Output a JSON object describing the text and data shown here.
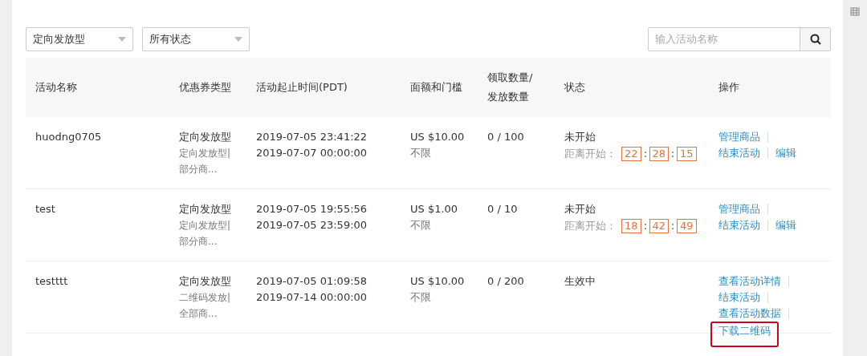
{
  "filters": [
    {
      "value": "定向发放型"
    },
    {
      "value": "所有状态"
    }
  ],
  "search": {
    "placeholder": "输入活动名称"
  },
  "table": {
    "columns": [
      "活动名称",
      "优惠券类型",
      "活动起止时间(PDT)",
      "面额和门槛",
      "领取数量/发放数量",
      "状态",
      "操作"
    ],
    "rows": [
      {
        "name": "huodng0705",
        "type": "定向发放型",
        "type_detail": "定向发放型|部分商...",
        "start": "2019-07-05 23:41:22",
        "end": "2019-07-07 00:00:00",
        "amount": "US $10.00",
        "threshold": "不限",
        "count": "0 / 100",
        "status": "未开始",
        "countdown": {
          "label": "距离开始：",
          "parts": [
            "22",
            "28",
            "15"
          ]
        },
        "actions": [
          [
            {
              "label": "管理商品",
              "highlighted": false
            }
          ],
          [
            {
              "label": "结束活动",
              "highlighted": false
            },
            {
              "label": "编辑",
              "highlighted": false
            }
          ]
        ]
      },
      {
        "name": "test",
        "type": "定向发放型",
        "type_detail": "定向发放型|部分商...",
        "start": "2019-07-05 19:55:56",
        "end": "2019-07-05 23:59:00",
        "amount": "US $1.00",
        "threshold": "不限",
        "count": "0 / 10",
        "status": "未开始",
        "countdown": {
          "label": "距离开始：",
          "parts": [
            "18",
            "42",
            "49"
          ]
        },
        "actions": [
          [
            {
              "label": "管理商品",
              "highlighted": false
            }
          ],
          [
            {
              "label": "结束活动",
              "highlighted": false
            },
            {
              "label": "编辑",
              "highlighted": false
            }
          ]
        ]
      },
      {
        "name": "testttt",
        "type": "定向发放型",
        "type_detail": "二维码发放|全部商...",
        "start": "2019-07-05 01:09:58",
        "end": "2019-07-14 00:00:00",
        "amount": "US $10.00",
        "threshold": "不限",
        "count": "0 / 200",
        "status": "生效中",
        "actions": [
          [
            {
              "label": "查看活动详情",
              "highlighted": false
            }
          ],
          [
            {
              "label": "结束活动",
              "highlighted": false
            }
          ],
          [
            {
              "label": "查看活动数据",
              "highlighted": false
            }
          ],
          [
            {
              "label": "下载二维码",
              "highlighted": true
            }
          ]
        ]
      }
    ]
  }
}
